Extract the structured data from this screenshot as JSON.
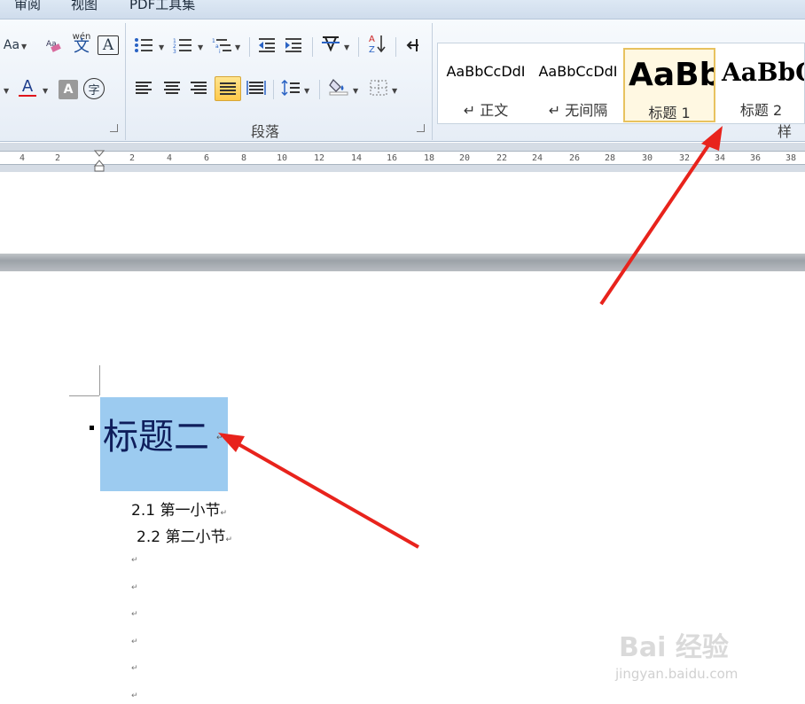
{
  "tabs": [
    "审阅",
    "视图",
    "PDF工具集"
  ],
  "ribbon": {
    "font_buttons_row1": [
      "Aa",
      "wén 文",
      "A"
    ],
    "font_buttons_row2": [
      "A",
      "A",
      "字"
    ],
    "paragraph_label": "段落",
    "styles_label": "样式",
    "styles": [
      {
        "preview": "AaBbCcDdI",
        "name": "↵ 正文"
      },
      {
        "preview": "AaBbCcDdI",
        "name": "↵ 无间隔"
      },
      {
        "preview": "AaBb",
        "name": "标题 1"
      },
      {
        "preview": "AaBbC",
        "name": "标题 2"
      }
    ]
  },
  "ruler": {
    "ticks": [
      "4",
      "2",
      "2",
      "4",
      "6",
      "8",
      "10",
      "12",
      "14",
      "16",
      "18",
      "20",
      "22",
      "24",
      "26",
      "28",
      "30",
      "32",
      "34",
      "36",
      "38"
    ]
  },
  "document": {
    "heading": "标题二",
    "items": [
      {
        "text": "2.1 第一小节"
      },
      {
        "text": "2.2 第二小节"
      }
    ],
    "paragraph_mark": "↵"
  },
  "watermark": {
    "logo": "Bai 经验",
    "url": "jingyan.baidu.com"
  },
  "colors": {
    "selection": "#9ccbf0",
    "arrow": "#e8231c",
    "selected_style_border": "#e8c25f"
  }
}
